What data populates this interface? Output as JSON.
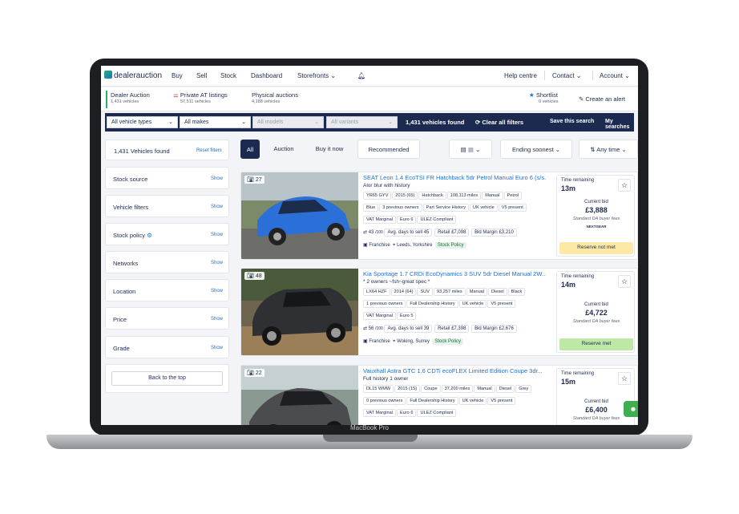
{
  "device": {
    "model": "MacBook Pro"
  },
  "nav": {
    "logo": "dealerauction",
    "items": [
      "Buy",
      "Sell",
      "Stock",
      "Dashboard",
      "Storefronts"
    ],
    "help": "Help centre",
    "contact": "Contact",
    "account": "Account"
  },
  "subnav": {
    "tabs": [
      {
        "label": "Dealer Auction",
        "count": "1,431 vehicles"
      },
      {
        "label": "Private AT listings",
        "count": "57,511 vehicles"
      },
      {
        "label": "Physical auctions",
        "count": "4,188 vehicles"
      }
    ],
    "shortlist": {
      "label": "Shortlist",
      "count": "0 vehicles"
    },
    "alert": "Create an alert"
  },
  "filters": {
    "vehicle_types": "All vehicle types",
    "makes": "All makes",
    "models": "All models",
    "variants": "All variants",
    "found": "1,431 vehicles found",
    "clear": "Clear all filters",
    "save": "Save this search",
    "my_searches": "My searches"
  },
  "sidebar": {
    "found": "1,431 Vehicles found",
    "reset": "Reset filters",
    "sections": [
      "Stock source",
      "Vehicle filters",
      "Stock policy",
      "Networks",
      "Location",
      "Price",
      "Grade"
    ],
    "show": "Show",
    "back": "Back to the top"
  },
  "toolbar": {
    "tabs": [
      "All",
      "Auction",
      "Buy it now"
    ],
    "recommended": "Recommended",
    "sort": "Ending soonest",
    "time": "Any time"
  },
  "listings": [
    {
      "photos": "27",
      "title": "SEAT Leon 1.4 EcoTSI FR Hatchback 5dr Petrol Manual Euro 6 (s/s...",
      "subtitle": "Alor blur with history",
      "row1": [
        "YR65 GYV",
        "2015 (65)",
        "Hatchback",
        "108,113 miles",
        "Manual",
        "Petrol"
      ],
      "row2": [
        "Blue",
        "3 previous owners",
        "Part Service History",
        "UK vehicle",
        "V5 present"
      ],
      "row3": [
        "VAT Marginal",
        "Euro 6",
        "ULEZ Compliant"
      ],
      "score": "43",
      "days": "Avg. days to sell 45",
      "retail": "Retail £7,098",
      "margin": "Bid Margin £3,210",
      "seller": "Franchise",
      "location": "Leeds, Yorkshire",
      "policy": "Stock Policy",
      "time_label": "Time remaining",
      "time": "13m",
      "bid_label": "Current bid",
      "bid": "£3,888",
      "fees": "Standard DA buyer fees",
      "badge": "NEXTGEAR",
      "reserve": "Reserve not met",
      "reserve_color": "#fde9a6"
    },
    {
      "photos": "48",
      "title": "Kia Sportage 1.7 CRDi EcoDynamics 3 SUV 5dr Diesel Manual 2W...",
      "subtitle": "* 2 owners ~fsh~great spec *",
      "row1": [
        "LX64 HZF",
        "2014 (64)",
        "SUV",
        "93,257 miles",
        "Manual",
        "Diesel",
        "Black"
      ],
      "row2": [
        "1 previous owners",
        "Full Dealership History",
        "UK vehicle",
        "V5 present"
      ],
      "row3": [
        "VAT Marginal",
        "Euro 5"
      ],
      "score": "56",
      "days": "Avg. days to sell 39",
      "retail": "Retail £7,398",
      "margin": "Bid Margin £2,676",
      "seller": "Franchise",
      "location": "Woking, Surrey",
      "policy": "Stock Policy",
      "time_label": "Time remaining",
      "time": "14m",
      "bid_label": "Current bid",
      "bid": "£4,722",
      "fees": "Standard DA buyer fees",
      "badge": "",
      "reserve": "Reserve met",
      "reserve_color": "#bfe8a6"
    },
    {
      "photos": "22",
      "title": "Vauxhall Astra GTC 1.6 CDTi ecoFLEX Limited Edition Coupe 3dr...",
      "subtitle": "Full history 1 owner",
      "row1": [
        "DL15 WMW",
        "2015 (15)",
        "Coupe",
        "37,200 miles",
        "Manual",
        "Diesel",
        "Grey"
      ],
      "row2": [
        "0 previous owners",
        "Full Dealership History",
        "UK vehicle",
        "V5 present"
      ],
      "row3": [
        "VAT Marginal",
        "Euro 6",
        "ULEZ Compliant"
      ],
      "score": "",
      "days": "",
      "retail": "",
      "margin": "",
      "seller": "",
      "location": "",
      "policy": "",
      "time_label": "Time remaining",
      "time": "15m",
      "bid_label": "Current bid",
      "bid": "£6,400",
      "fees": "Standard DA buyer fees",
      "badge": "",
      "reserve": "",
      "reserve_color": "#ffffff"
    }
  ]
}
